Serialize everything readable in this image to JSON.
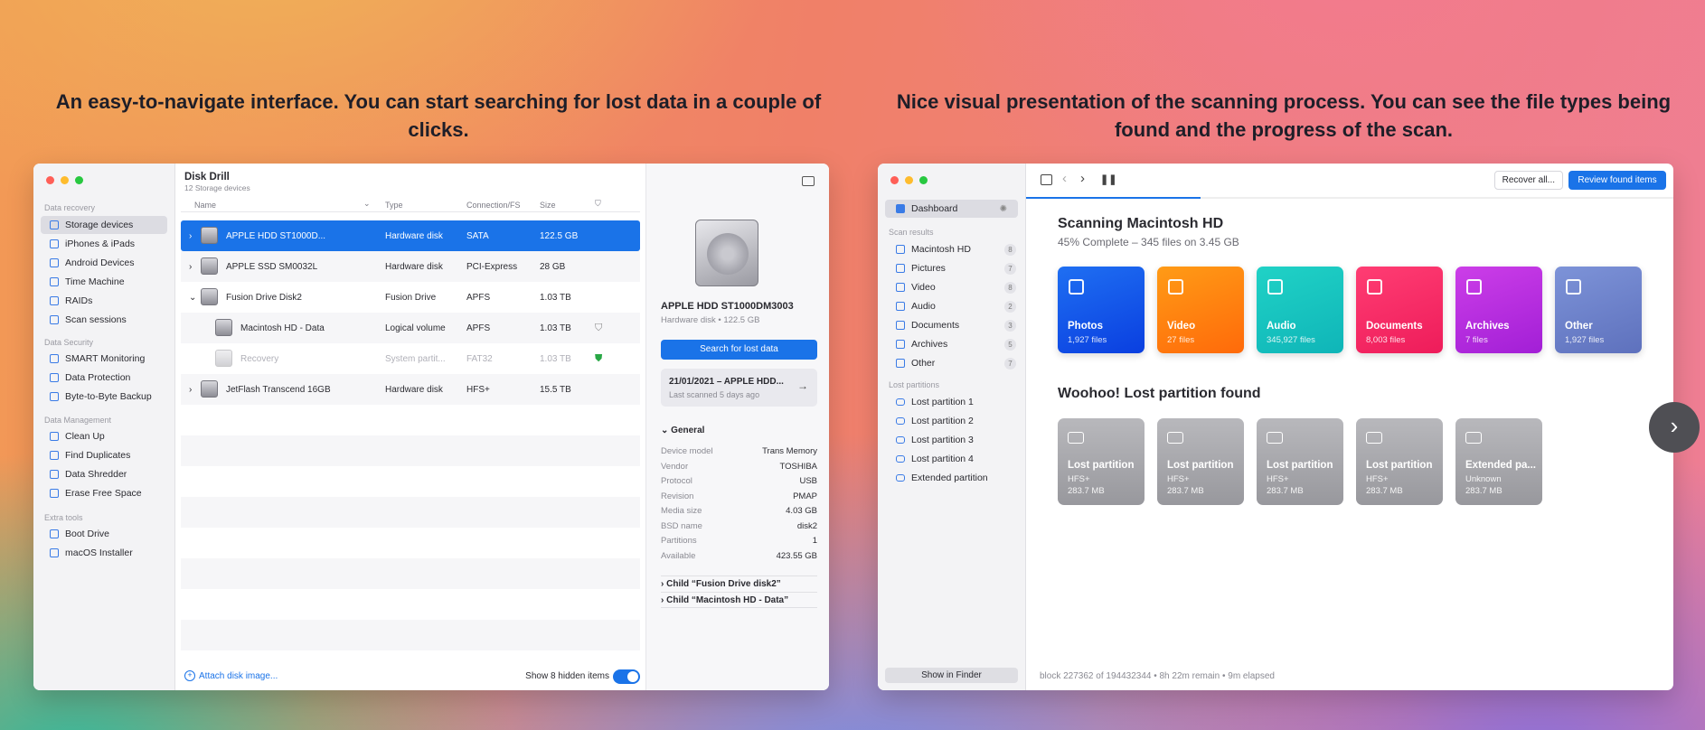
{
  "captions": {
    "left": "An easy-to-navigate interface. You can start searching for lost data in a couple of clicks.",
    "right": "Nice visual presentation of the scanning process. You can see the file types being found and the progress of the scan."
  },
  "w1": {
    "title": "Disk Drill",
    "subtitle": "12 Storage devices",
    "sections": {
      "recovery": "Data recovery",
      "security": "Data Security",
      "management": "Data Management",
      "extra": "Extra tools"
    },
    "recovery_items": [
      "Storage devices",
      "iPhones & iPads",
      "Android Devices",
      "Time Machine",
      "RAIDs",
      "Scan sessions"
    ],
    "security_items": [
      "SMART Monitoring",
      "Data Protection",
      "Byte-to-Byte Backup"
    ],
    "management_items": [
      "Clean Up",
      "Find Duplicates",
      "Data Shredder",
      "Erase Free Space"
    ],
    "extra_items": [
      "Boot Drive",
      "macOS Installer"
    ],
    "columns": {
      "name": "Name",
      "type": "Type",
      "conn": "Connection/FS",
      "size": "Size"
    },
    "rows": [
      {
        "name": "APPLE HDD ST1000D...",
        "type": "Hardware disk",
        "conn": "SATA",
        "size": "122.5 GB"
      },
      {
        "name": "APPLE SSD SM0032L",
        "type": "Hardware disk",
        "conn": "PCI-Express",
        "size": "28 GB"
      },
      {
        "name": "Fusion Drive Disk2",
        "type": "Fusion Drive",
        "conn": "APFS",
        "size": "1.03 TB"
      },
      {
        "name": "Macintosh HD - Data",
        "type": "Logical volume",
        "conn": "APFS",
        "size": "1.03 TB"
      },
      {
        "name": "Recovery",
        "type": "System partit...",
        "conn": "FAT32",
        "size": "1.03 TB"
      },
      {
        "name": "JetFlash Transcend 16GB",
        "type": "Hardware disk",
        "conn": "HFS+",
        "size": "15.5 TB"
      }
    ],
    "attach": "Attach disk image...",
    "hidden": "Show 8 hidden items",
    "detail": {
      "disk_name": "APPLE HDD ST1000DM3003",
      "disk_sub": "Hardware disk • 122.5 GB",
      "search_btn": "Search for lost data",
      "session_title": "21/01/2021 – APPLE HDD...",
      "session_sub": "Last scanned 5 days ago",
      "general": "General",
      "props": [
        [
          "Device model",
          "Trans Memory"
        ],
        [
          "Vendor",
          "TOSHIBA"
        ],
        [
          "Protocol",
          "USB"
        ],
        [
          "Revision",
          "PMAP"
        ],
        [
          "Media size",
          "4.03 GB"
        ],
        [
          "BSD name",
          "disk2"
        ],
        [
          "Partitions",
          "1"
        ],
        [
          "Available",
          "423.55 GB"
        ]
      ],
      "child1": "Child “Fusion Drive disk2”",
      "child2": "Child “Macintosh HD - Data”"
    }
  },
  "w2": {
    "dashboard": "Dashboard",
    "scan_results": "Scan results",
    "results": [
      [
        "Macintosh HD",
        "8"
      ],
      [
        "Pictures",
        "7"
      ],
      [
        "Video",
        "8"
      ],
      [
        "Audio",
        "2"
      ],
      [
        "Documents",
        "3"
      ],
      [
        "Archives",
        "5"
      ],
      [
        "Other",
        "7"
      ]
    ],
    "lost_partitions": "Lost partitions",
    "partitions": [
      "Lost partition 1",
      "Lost partition 2",
      "Lost partition 3",
      "Lost partition 4",
      "Extended partition"
    ],
    "show_finder": "Show in Finder",
    "recover_all": "Recover all...",
    "review": "Review found items",
    "scan_title": "Scanning Macintosh HD",
    "scan_sub": "45% Complete – 345 files on 3.45 GB",
    "progress": 0.45,
    "tiles": [
      [
        "Photos",
        "1,927 files",
        "#1f6ff2",
        "#0a3fe0"
      ],
      [
        "Video",
        "27 files",
        "#ff9b16",
        "#ff6a0a"
      ],
      [
        "Audio",
        "345,927 files",
        "#20d2c6",
        "#0fb5b8"
      ],
      [
        "Documents",
        "8,003 files",
        "#ff3d73",
        "#ee1c5a"
      ],
      [
        "Archives",
        "7 files",
        "#cc3ee8",
        "#a21fd6"
      ],
      [
        "Other",
        "1,927 files",
        "#7d93d8",
        "#5e71bd"
      ]
    ],
    "found_title": "Woohoo! Lost partition found",
    "ptiles": [
      [
        "Lost partition",
        "HFS+",
        "283.7 MB"
      ],
      [
        "Lost partition",
        "HFS+",
        "283.7 MB"
      ],
      [
        "Lost partition",
        "HFS+",
        "283.7 MB"
      ],
      [
        "Lost partition",
        "HFS+",
        "283.7 MB"
      ],
      [
        "Extended pa...",
        "Unknown",
        "283.7 MB"
      ]
    ],
    "status": "block 227362 of 194432344 • 8h 22m remain • 9m elapsed"
  }
}
